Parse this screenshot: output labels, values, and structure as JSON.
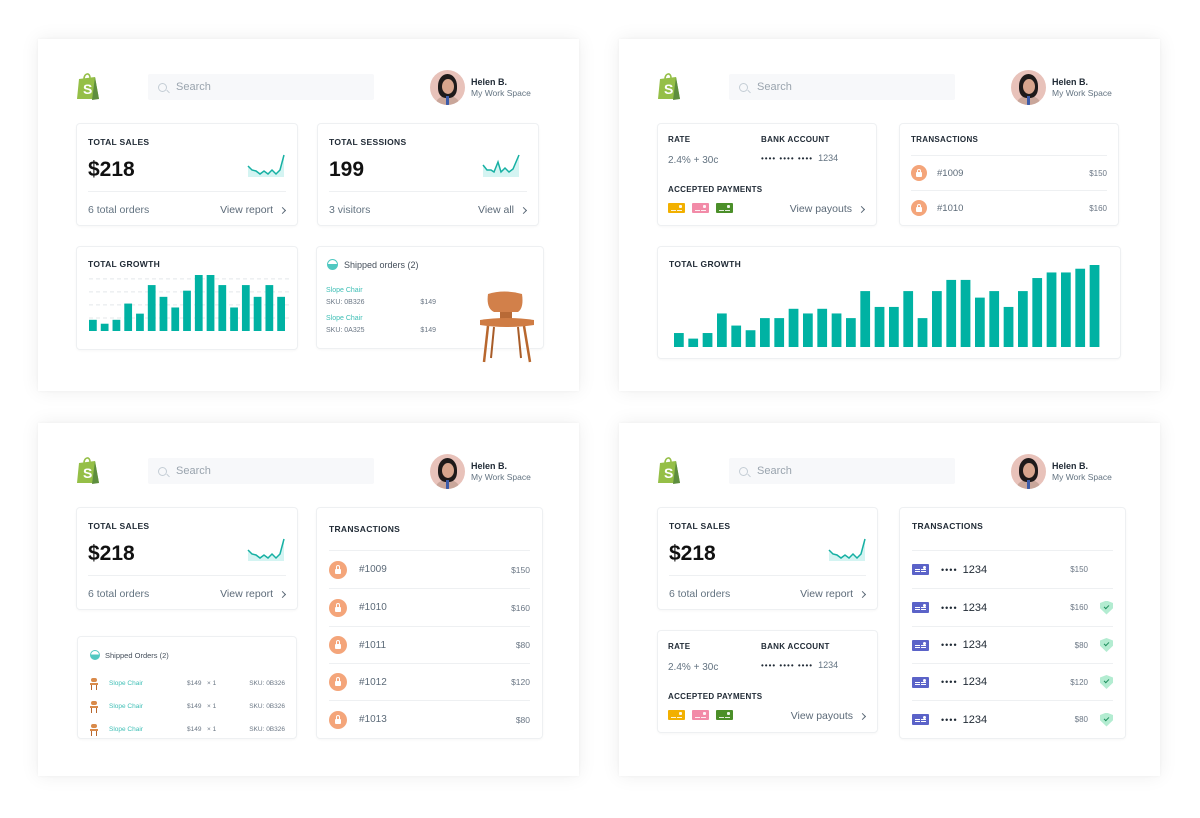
{
  "common": {
    "search_placeholder": "Search",
    "user_name": "Helen B.",
    "user_space": "My Work Space",
    "accent": "#00b2a3",
    "brand_green": "#7ab733"
  },
  "panel1": {
    "total_sales": {
      "label": "TOTAL SALES",
      "value": "$218",
      "sub": "6 total orders",
      "link": "View report"
    },
    "total_sessions": {
      "label": "TOTAL SESSIONS",
      "value": "199",
      "sub": "3 visitors",
      "link": "View all"
    },
    "growth": {
      "label": "TOTAL GROWTH",
      "values": [
        20,
        13,
        20,
        49,
        31,
        82,
        61,
        42,
        72,
        100,
        100,
        82,
        42,
        82,
        61,
        82,
        61
      ]
    },
    "shipped": {
      "title": "Shipped orders (2)",
      "items": [
        {
          "name": "Slope Chair",
          "sku": "SKU: 0B326",
          "price": "$149"
        },
        {
          "name": "Slope Chair",
          "sku": "SKU: 0A325",
          "price": "$149"
        }
      ]
    }
  },
  "panel2": {
    "rate_label": "RATE",
    "rate_value": "2.4% + 30c",
    "bank_label": "BANK ACCOUNT",
    "bank_value_dots": "•••• •••• ••••",
    "bank_value_last": "1234",
    "accepted_label": "ACCEPTED PAYMENTS",
    "payment_colors": [
      "#f2b000",
      "#f28ba8",
      "#4b8f29"
    ],
    "payouts_link": "View payouts",
    "transactions": {
      "label": "TRANSACTIONS",
      "rows": [
        {
          "id": "#1009",
          "amount": "$150"
        },
        {
          "id": "#1010",
          "amount": "$160"
        }
      ]
    },
    "growth": {
      "label": "TOTAL GROWTH",
      "values": [
        15,
        9,
        15,
        36,
        23,
        18,
        31,
        31,
        41,
        36,
        41,
        36,
        31,
        60,
        43,
        43,
        60,
        31,
        60,
        72,
        72,
        53,
        60,
        43,
        60,
        74,
        80,
        80,
        84,
        88
      ]
    }
  },
  "panel3": {
    "total_sales": {
      "label": "TOTAL SALES",
      "value": "$218",
      "sub": "6 total orders",
      "link": "View report"
    },
    "shipped": {
      "title": "Shipped Orders (2)",
      "items": [
        {
          "name": "Slope Chair",
          "price": "$149",
          "qty": "× 1",
          "sku": "SKU: 0B326"
        },
        {
          "name": "Slope Chair",
          "price": "$149",
          "qty": "× 1",
          "sku": "SKU: 0B326"
        },
        {
          "name": "Slope Chair",
          "price": "$149",
          "qty": "× 1",
          "sku": "SKU: 0B326"
        }
      ]
    },
    "transactions": {
      "label": "TRANSACTIONS",
      "rows": [
        {
          "id": "#1009",
          "amount": "$150"
        },
        {
          "id": "#1010",
          "amount": "$160"
        },
        {
          "id": "#1011",
          "amount": "$80"
        },
        {
          "id": "#1012",
          "amount": "$120"
        },
        {
          "id": "#1013",
          "amount": "$80"
        }
      ]
    }
  },
  "panel4": {
    "total_sales": {
      "label": "TOTAL SALES",
      "value": "$218",
      "sub": "6 total orders",
      "link": "View report"
    },
    "rate_label": "RATE",
    "rate_value": "2.4% + 30c",
    "bank_label": "BANK ACCOUNT",
    "bank_value_dots": "•••• •••• ••••",
    "bank_value_last": "1234",
    "accepted_label": "ACCEPTED PAYMENTS",
    "payouts_link": "View payouts",
    "transactions": {
      "label": "TRANSACTIONS",
      "rows": [
        {
          "dots": "••••",
          "last4": "1234",
          "amount": "$150",
          "verified": false
        },
        {
          "dots": "••••",
          "last4": "1234",
          "amount": "$160",
          "verified": true
        },
        {
          "dots": "••••",
          "last4": "1234",
          "amount": "$80",
          "verified": true
        },
        {
          "dots": "••••",
          "last4": "1234",
          "amount": "$120",
          "verified": true
        },
        {
          "dots": "••••",
          "last4": "1234",
          "amount": "$80",
          "verified": true
        }
      ]
    }
  }
}
